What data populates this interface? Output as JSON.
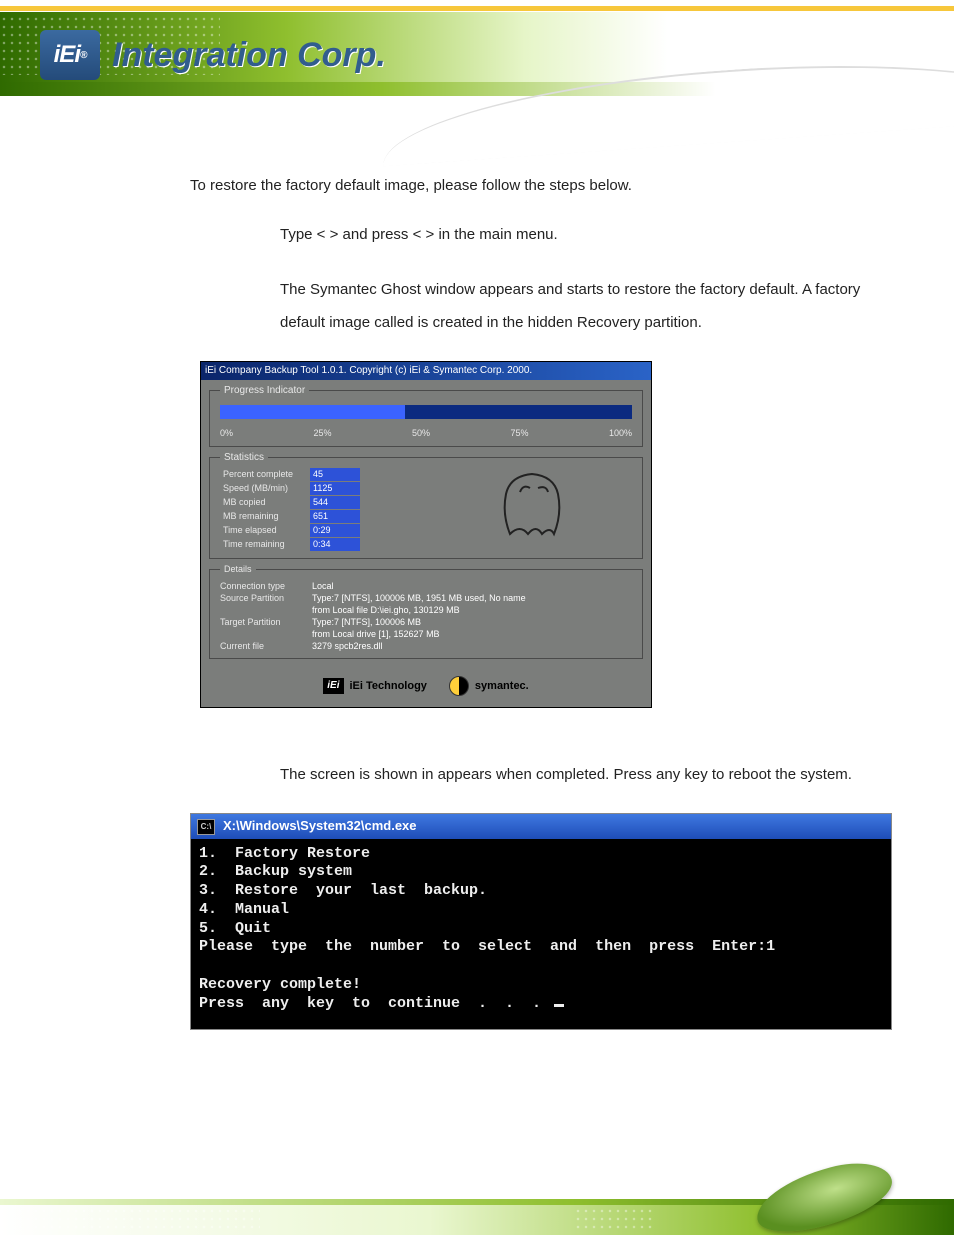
{
  "brand": {
    "logo_mark": "iEi",
    "logo_text": "Integration Corp.",
    "registered": "®"
  },
  "intro": "To restore the factory default image, please follow the steps below.",
  "step1": "Type <  > and press <        > in the main menu.",
  "step2": "The Symantec Ghost window appears and starts to restore the factory default. A factory default image called               is created in the hidden Recovery partition.",
  "step3": "The screen is shown in                    appears when completed. Press any key to reboot the system.",
  "ghost": {
    "titlebar": "iEi Company Backup Tool 1.0.1.  Copyright (c) iEi & Symantec Corp. 2000.",
    "section_progress": "Progress Indicator",
    "ticks": [
      "0%",
      "25%",
      "50%",
      "75%",
      "100%"
    ],
    "section_stats": "Statistics",
    "stats": {
      "labels": [
        "Percent complete",
        "Speed (MB/min)",
        "MB copied",
        "MB remaining",
        "Time elapsed",
        "Time remaining"
      ],
      "values": [
        "45",
        "1125",
        "544",
        "651",
        "0:29",
        "0:34"
      ]
    },
    "section_details": "Details",
    "details": {
      "rows": [
        {
          "l": "Connection type",
          "v": "Local"
        },
        {
          "l": "Source Partition",
          "v": "Type:7 [NTFS], 100006 MB, 1951 MB used, No name"
        },
        {
          "l": "",
          "v": "from Local file D:\\iei.gho, 130129 MB"
        },
        {
          "l": "Target Partition",
          "v": "Type:7 [NTFS], 100006 MB"
        },
        {
          "l": "",
          "v": "from Local drive [1], 152627 MB"
        },
        {
          "l": "Current file",
          "v": "3279 spcb2res.dll"
        }
      ]
    },
    "footer_iei": "iEi Technology",
    "footer_sym": "symantec.",
    "iei_mark": "iEi"
  },
  "cmd": {
    "title": "X:\\Windows\\System32\\cmd.exe",
    "icon_text": "C:\\",
    "body": "1.  Factory Restore\n2.  Backup system\n3.  Restore  your  last  backup.\n4.  Manual\n5.  Quit\nPlease  type  the  number  to  select  and  then  press  Enter:1\n\nRecovery complete!\nPress  any  key  to  continue  .  .  . "
  }
}
